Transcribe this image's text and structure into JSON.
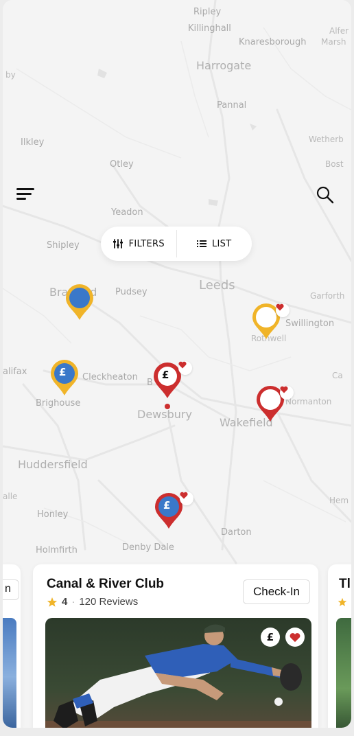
{
  "toolbar": {
    "menu_icon": "hamburger-menu-icon",
    "search_icon": "search-icon"
  },
  "controls": {
    "filters_label": "FILTERS",
    "filters_icon": "sliders-icon",
    "list_label": "LIST",
    "list_icon": "list-icon"
  },
  "map": {
    "place_names": {
      "ripley": "Ripley",
      "killinghall": "Killinghall",
      "knaresborough": "Knaresborough",
      "alfer": "Alfer",
      "marsh": "Marsh",
      "harrogate": "Harrogate",
      "pannal": "Pannal",
      "ilkley": "Ilkley",
      "otley": "Otley",
      "wetherby": "Wetherb",
      "boston": "Bost",
      "yeadon": "Yeadon",
      "shipley": "Shipley",
      "bradford": "Bradford",
      "pudsey": "Pudsey",
      "leeds": "Leeds",
      "garforth": "Garforth",
      "swillington": "Swillington",
      "rothwell": "Rothwell",
      "halifax": "alifax",
      "cleckheaton": "Cleckheaton",
      "batley": "B",
      "castleford": "Ca",
      "brighouse": "Brighouse",
      "dewsbury": "Dewsbury",
      "wakefield": "Wakefield",
      "normanton": "Normanton",
      "huddersfield": "Huddersfield",
      "elland": "alle",
      "honley": "Honley",
      "holmfirth": "Holmfirth",
      "denby_dale": "Denby Dale",
      "darton": "Darton",
      "hemsworth": "Hem",
      "by": "by"
    },
    "pin_pound_symbol": "£",
    "colors": {
      "pin_yellow": "#f0b429",
      "pin_blue": "#3a78c9",
      "pin_red": "#cc2e2e"
    }
  },
  "cards": {
    "left_partial_text": "n",
    "main": {
      "title": "Canal & River Club",
      "rating": "4",
      "reviews": "120 Reviews",
      "checkin_label": "Check-In",
      "pound_symbol": "£",
      "star_icon": "star-icon",
      "heart_icon": "heart-icon"
    },
    "right_partial_title": "Tl"
  }
}
